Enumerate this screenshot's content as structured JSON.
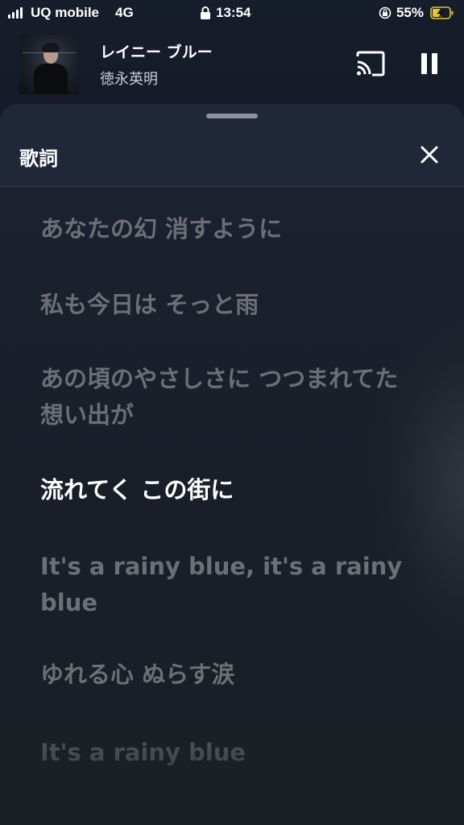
{
  "status_bar": {
    "carrier": "UQ mobile",
    "network": "4G",
    "time": "13:54",
    "battery_percent": "55%",
    "icons": [
      "signal-icon",
      "lock-icon",
      "orientation-lock-icon",
      "battery-charging-icon"
    ]
  },
  "now_playing": {
    "title": "レイニー ブルー",
    "artist": "徳永英明",
    "cast_icon": "cast-icon",
    "pause_icon": "pause-icon"
  },
  "lyrics_panel": {
    "title": "歌詞",
    "close_icon": "close-icon",
    "lines": [
      {
        "text": "あなたの幻 消すように",
        "state": "past"
      },
      {
        "text": "私も今日は そっと雨",
        "state": "past"
      },
      {
        "text": "あの頃のやさしさに つつまれてた想い出が",
        "state": "past"
      },
      {
        "text": "流れてく この街に",
        "state": "current"
      },
      {
        "text": "It's a rainy blue, it's a rainy blue",
        "state": "upcoming"
      },
      {
        "text": "ゆれる心 ぬらす涙",
        "state": "upcoming"
      },
      {
        "text": "It's a rainy blue",
        "state": "upcoming"
      }
    ]
  },
  "colors": {
    "active_lyric": "#ffffff",
    "inactive_lyric": "#6c6f75",
    "sheet_header": "#1f2739",
    "background": "#141a24"
  }
}
